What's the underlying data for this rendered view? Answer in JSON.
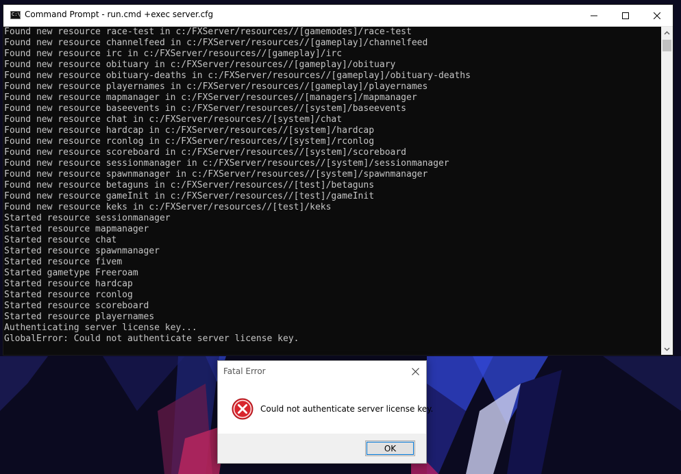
{
  "window": {
    "title": "Command Prompt - run.cmd  +exec server.cfg",
    "icon": "cmd-icon",
    "icon_text": "C:\\."
  },
  "console": {
    "lines": [
      "Found new resource race-test in c:/FXServer/resources//[gamemodes]/race-test",
      "Found new resource channelfeed in c:/FXServer/resources//[gameplay]/channelfeed",
      "Found new resource irc in c:/FXServer/resources//[gameplay]/irc",
      "Found new resource obituary in c:/FXServer/resources//[gameplay]/obituary",
      "Found new resource obituary-deaths in c:/FXServer/resources//[gameplay]/obituary-deaths",
      "Found new resource playernames in c:/FXServer/resources//[gameplay]/playernames",
      "Found new resource mapmanager in c:/FXServer/resources//[managers]/mapmanager",
      "Found new resource baseevents in c:/FXServer/resources//[system]/baseevents",
      "Found new resource chat in c:/FXServer/resources//[system]/chat",
      "Found new resource hardcap in c:/FXServer/resources//[system]/hardcap",
      "Found new resource rconlog in c:/FXServer/resources//[system]/rconlog",
      "Found new resource scoreboard in c:/FXServer/resources//[system]/scoreboard",
      "Found new resource sessionmanager in c:/FXServer/resources//[system]/sessionmanager",
      "Found new resource spawnmanager in c:/FXServer/resources//[system]/spawnmanager",
      "Found new resource betaguns in c:/FXServer/resources//[test]/betaguns",
      "Found new resource gameInit in c:/FXServer/resources//[test]/gameInit",
      "Found new resource keks in c:/FXServer/resources//[test]/keks",
      "Started resource sessionmanager",
      "Started resource mapmanager",
      "Started resource chat",
      "Started resource spawnmanager",
      "Started resource fivem",
      "Started gametype Freeroam",
      "Started resource hardcap",
      "Started resource rconlog",
      "Started resource scoreboard",
      "Started resource playernames",
      "Authenticating server license key...",
      "GlobalError: Could not authenticate server license key."
    ],
    "text_color": "#c6c6c6",
    "background": "#0c0c0c"
  },
  "dialog": {
    "title": "Fatal Error",
    "message": "Could not authenticate server license key.",
    "ok_label": "OK",
    "icon": "error-icon",
    "accent": "#d8262e"
  }
}
